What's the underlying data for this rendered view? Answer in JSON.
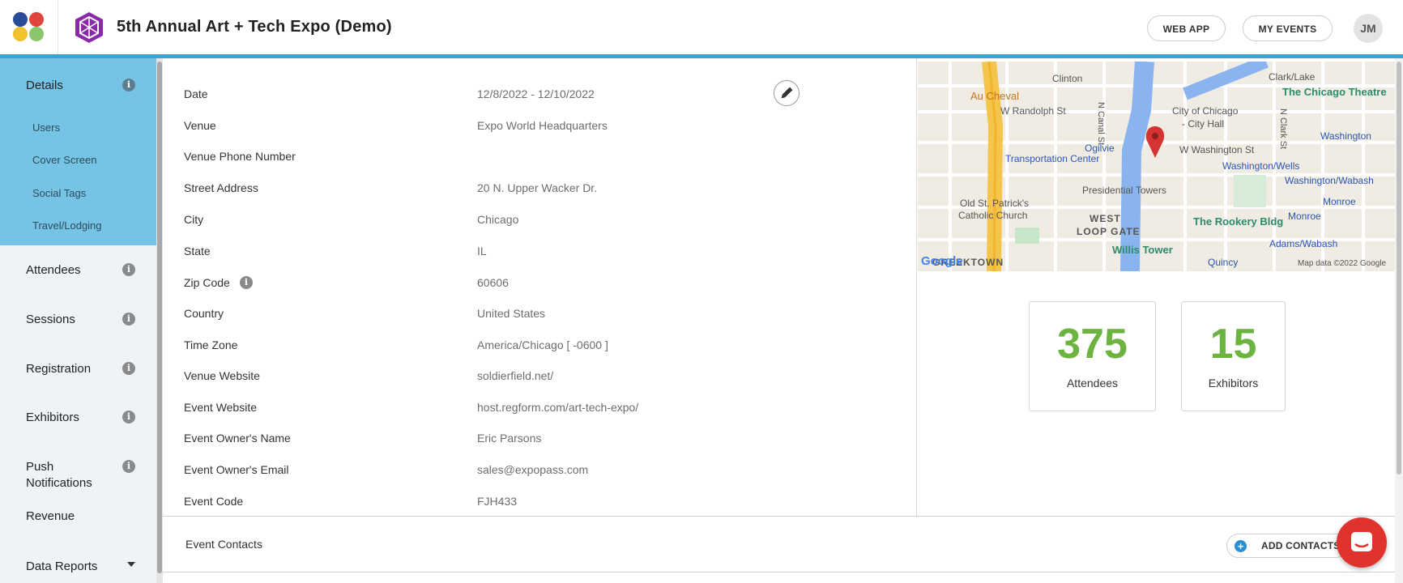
{
  "header": {
    "event_title": "5th Annual Art + Tech Expo (Demo)",
    "web_app_label": "WEB APP",
    "my_events_label": "MY EVENTS",
    "avatar_initials": "JM",
    "accent_color": "#3aa3d6"
  },
  "sidebar": {
    "active_bg": "#75c3e5",
    "items": [
      {
        "label": "Details"
      },
      {
        "label": "Users"
      },
      {
        "label": "Cover Screen"
      },
      {
        "label": "Social Tags"
      },
      {
        "label": "Travel/Lodging"
      },
      {
        "label": "Attendees"
      },
      {
        "label": "Sessions"
      },
      {
        "label": "Registration"
      },
      {
        "label": "Exhibitors"
      },
      {
        "label": "Push"
      },
      {
        "label": "Notifications"
      },
      {
        "label": "Revenue"
      },
      {
        "label": "Data Reports"
      }
    ]
  },
  "details": {
    "rows": [
      {
        "label": "Date",
        "value": "12/8/2022 - 12/10/2022"
      },
      {
        "label": "Venue",
        "value": "Expo World Headquarters"
      },
      {
        "label": "Venue Phone Number",
        "value": ""
      },
      {
        "label": "Street Address",
        "value": "20 N. Upper Wacker Dr."
      },
      {
        "label": "City",
        "value": "Chicago"
      },
      {
        "label": "State",
        "value": "IL"
      },
      {
        "label": "Zip Code",
        "value": "60606"
      },
      {
        "label": "Country",
        "value": "United States"
      },
      {
        "label": "Time Zone",
        "value": "America/Chicago [ -0600 ]"
      },
      {
        "label": "Venue Website",
        "value": "soldierfield.net/"
      },
      {
        "label": "Event Website",
        "value": "host.regform.com/art-tech-expo/"
      },
      {
        "label": "Event Owner's Name",
        "value": "Eric Parsons"
      },
      {
        "label": "Event Owner's Email",
        "value": "sales@expopass.com"
      },
      {
        "label": "Event Code",
        "value": "FJH433"
      }
    ]
  },
  "map": {
    "labels": {
      "clinton": "Clinton",
      "clark_lake": "Clark/Lake",
      "chicago_theatre": "The Chicago Theatre",
      "au_cheval": "Au Cheval",
      "w_randolph": "W Randolph St",
      "city_hall": "City of Chicago",
      "city_hall2": "- City Hall",
      "washington": "Washington",
      "ogilvie": "Ogilvie",
      "transportation_center": "Transportation Center",
      "w_washington": "W Washington St",
      "washington_wells": "Washington/Wells",
      "washington_wabash": "Washington/Wabash",
      "presidential_towers": "Presidential Towers",
      "old_st_patricks": "Old St. Patrick's",
      "catholic_church": "Catholic Church",
      "monroe": "Monroe",
      "west": "WEST",
      "rookery": "The Rookery Bldg",
      "monroe2": "Monroe",
      "loop_gate": "LOOP GATE",
      "adams_wabash": "Adams/Wabash",
      "willis_tower": "Willis Tower",
      "greektown": "GREEKTOWN",
      "quincy": "Quincy",
      "attribution": "Map data ©2022 Google",
      "google": "Google",
      "n_canal": "N Canal St",
      "n_clark": "N Clark St"
    }
  },
  "stats": {
    "attendees_count": "375",
    "attendees_label": "Attendees",
    "exhibitors_count": "15",
    "exhibitors_label": "Exhibitors",
    "number_color": "#6cb33f"
  },
  "contacts": {
    "title": "Event Contacts",
    "add_label": "ADD CONTACTS"
  }
}
